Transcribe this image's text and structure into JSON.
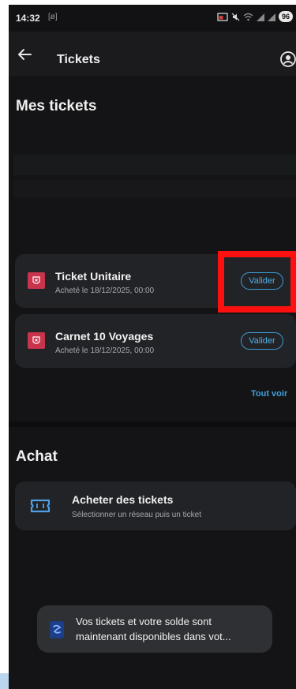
{
  "status_bar": {
    "time": "14:32",
    "notification_glyph": "[ø]",
    "battery": "96",
    "icons": [
      "cast-icon",
      "mute-icon",
      "wifi-icon",
      "signal-icon",
      "signal-icon"
    ]
  },
  "app_bar": {
    "title": "Tickets",
    "back_icon": "back-arrow-icon",
    "account_icon": "account-icon"
  },
  "my_tickets": {
    "title": "Mes tickets",
    "tickets": [
      {
        "name": "Ticket Unitaire",
        "purchased": "Acheté le 18/12/2025, 00:00",
        "action": "Valider"
      },
      {
        "name": "Carnet 10 Voyages",
        "purchased": "Acheté le 18/12/2025, 00:00",
        "action": "Valider"
      }
    ],
    "see_all": "Tout voir"
  },
  "purchase": {
    "title": "Achat",
    "buy_title": "Acheter des tickets",
    "buy_subtitle": "Sélectionner un réseau puis un ticket",
    "icon": "ticket-icon"
  },
  "toast": {
    "line1": "Vos tickets et votre solde sont",
    "line2": "maintenant disponibles dans vot..."
  },
  "colors": {
    "background": "#141416",
    "card": "#222326",
    "accent": "#4fb0ea",
    "brand_red": "#c8344c",
    "highlight": "#ff1010"
  }
}
